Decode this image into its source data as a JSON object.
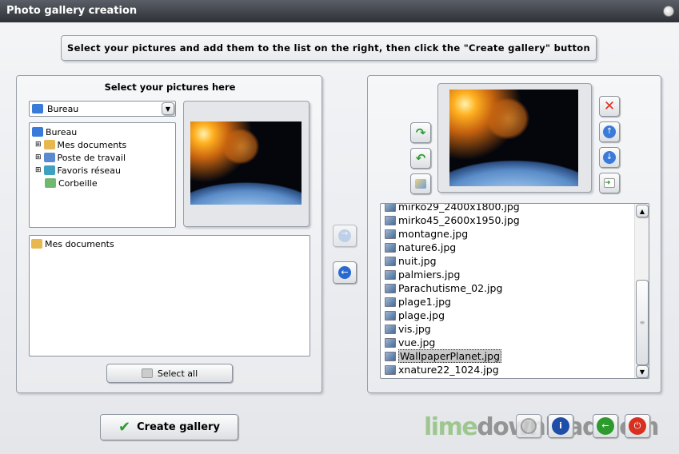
{
  "window": {
    "title": "Photo gallery creation"
  },
  "instruction": "Select your pictures and add them to the list on the right, then click the \"Create gallery\" button",
  "left": {
    "heading": "Select your pictures here",
    "location_select": "Bureau",
    "tree": [
      {
        "label": "Bureau",
        "icon": "desktop-icon"
      },
      {
        "label": "Mes documents",
        "icon": "folder-icon"
      },
      {
        "label": "Poste de travail",
        "icon": "computer-icon"
      },
      {
        "label": "Favoris réseau",
        "icon": "network-icon"
      },
      {
        "label": "Corbeille",
        "icon": "recycle-bin-icon"
      }
    ],
    "files": [
      {
        "label": "Mes documents",
        "icon": "folder-icon"
      }
    ],
    "select_all": "Select all"
  },
  "right": {
    "files": [
      "mirko29_2400x1800.jpg",
      "mirko45_2600x1950.jpg",
      "montagne.jpg",
      "nature6.jpg",
      "nuit.jpg",
      "palmiers.jpg",
      "Parachutisme_02.jpg",
      "plage1.jpg",
      "plage.jpg",
      "vis.jpg",
      "vue.jpg",
      "WallpaperPlanet.jpg",
      "xnature22_1024.jpg"
    ],
    "selected": "WallpaperPlanet.jpg"
  },
  "create_gallery": "Create gallery",
  "watermark": "limedownload.com",
  "colors": {
    "accent_green": "#2e9a2e",
    "delete_red": "#e03020",
    "nav_blue": "#2a6ad0"
  }
}
